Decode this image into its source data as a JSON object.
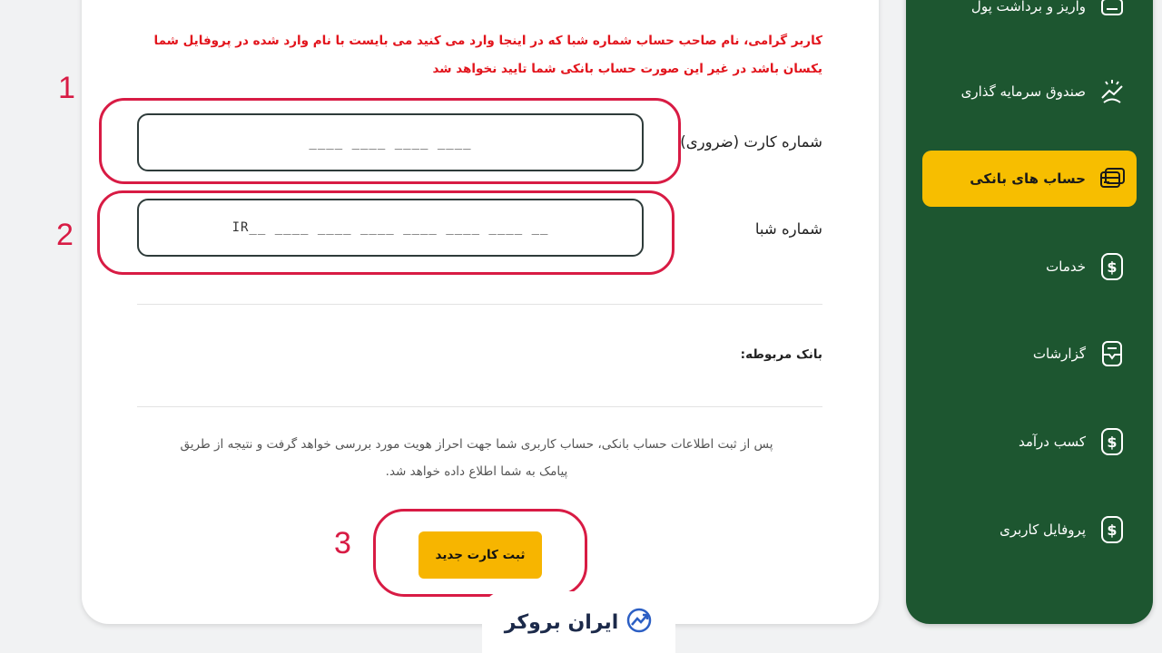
{
  "form": {
    "warning": "کاربر گرامی، نام صاحب حساب شماره شبا که در اینجا وارد می کنید می بایست با نام وارد شده در پروفایل شما یکسان باشد در غیر این صورت حساب بانکی شما تایید نخواهد شد",
    "card_label": "شماره کارت (ضروری)",
    "card_placeholder": "____ ____ ____ ____",
    "sheba_label": "شماره شبا",
    "sheba_placeholder": "IR__ ____ ____ ____ ____ ____ ____ __",
    "bank_label": "بانک مربوطه:",
    "info_text": "پس از ثبت اطلاعات حساب بانکی، حساب کاربری شما جهت احراز هویت مورد بررسی خواهد گرفت و نتیجه از طریق پیامک به شما اطلاع داده خواهد شد.",
    "submit_label": "ثبت کارت جدید"
  },
  "annotations": [
    "1",
    "2",
    "3"
  ],
  "sidebar": {
    "items": [
      {
        "label": "واریز و برداشت پول",
        "icon": "wallet-icon"
      },
      {
        "label": "صندوق سرمایه گذاری",
        "icon": "investment-fund-icon"
      },
      {
        "label": "حساب های بانکی",
        "icon": "bank-cards-icon",
        "active": true
      },
      {
        "label": "خدمات",
        "icon": "dollar-icon"
      },
      {
        "label": "گزارشات",
        "icon": "report-icon"
      },
      {
        "label": "کسب درآمد",
        "icon": "dollar-icon"
      },
      {
        "label": "پروفایل کاربری",
        "icon": "dollar-icon"
      }
    ]
  },
  "watermark": {
    "text": "ایران بروکر",
    "icon": "trend-arrow-icon"
  },
  "colors": {
    "sidebar": "#1d5630",
    "accent": "#f7be00",
    "warning": "#e2141c",
    "annotation": "#d81b44"
  }
}
